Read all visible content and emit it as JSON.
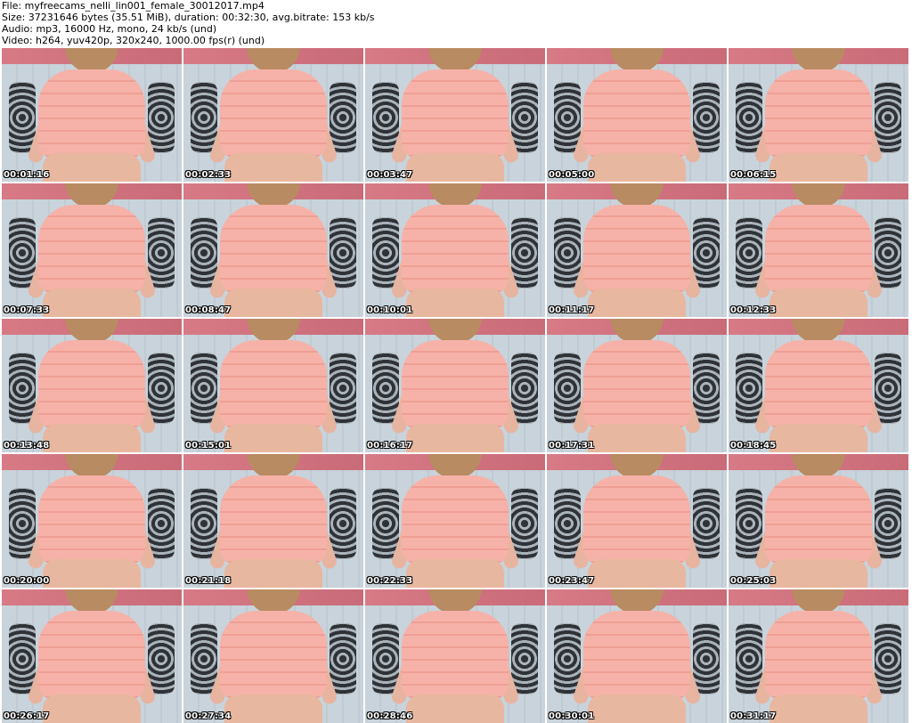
{
  "header": {
    "file_line": "File: myfreecams_nelli_lin001_female_30012017.mp4",
    "size_line": "Size: 37231646 bytes (35.51 MiB), duration: 00:32:30, avg.bitrate: 153 kb/s",
    "audio_line": "Audio: mp3, 16000 Hz, mono, 24 kb/s (und)",
    "video_line": "Video: h264, yuv420p, 320x240, 1000.00 fps(r) (und)"
  },
  "thumbnails": [
    {
      "timestamp": "00:01:16"
    },
    {
      "timestamp": "00:02:33"
    },
    {
      "timestamp": "00:03:47"
    },
    {
      "timestamp": "00:05:00"
    },
    {
      "timestamp": "00:06:15"
    },
    {
      "timestamp": "00:07:33"
    },
    {
      "timestamp": "00:08:47"
    },
    {
      "timestamp": "00:10:01"
    },
    {
      "timestamp": "00:11:17"
    },
    {
      "timestamp": "00:12:33"
    },
    {
      "timestamp": "00:13:48"
    },
    {
      "timestamp": "00:15:01"
    },
    {
      "timestamp": "00:16:17"
    },
    {
      "timestamp": "00:17:31"
    },
    {
      "timestamp": "00:18:45"
    },
    {
      "timestamp": "00:20:00"
    },
    {
      "timestamp": "00:21:18"
    },
    {
      "timestamp": "00:22:33"
    },
    {
      "timestamp": "00:23:47"
    },
    {
      "timestamp": "00:25:03"
    },
    {
      "timestamp": "00:26:17"
    },
    {
      "timestamp": "00:27:34"
    },
    {
      "timestamp": "00:28:46"
    },
    {
      "timestamp": "00:30:01"
    },
    {
      "timestamp": "00:31:17"
    }
  ]
}
